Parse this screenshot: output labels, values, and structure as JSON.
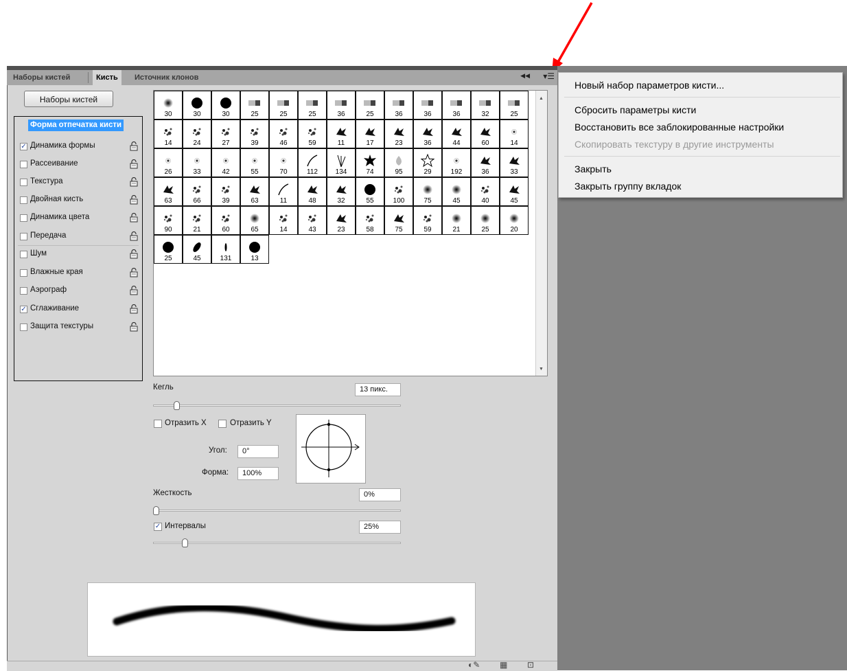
{
  "tabs": [
    {
      "label": "Наборы кистей",
      "active": false
    },
    {
      "label": "Кисть",
      "active": true
    },
    {
      "label": "Источник клонов",
      "active": false
    }
  ],
  "panel_controls": {
    "collapse_icon": "double-chevron-left-icon",
    "menu_icon": "panel-menu-icon"
  },
  "presets_button": "Наборы кистей",
  "options": {
    "header": "Форма отпечатка кисти",
    "items": [
      {
        "label": "Динамика формы",
        "checked": true,
        "lock": true
      },
      {
        "label": "Рассеивание",
        "checked": false,
        "lock": true
      },
      {
        "label": "Текстура",
        "checked": false,
        "lock": true
      },
      {
        "label": "Двойная кисть",
        "checked": false,
        "lock": true
      },
      {
        "label": "Динамика цвета",
        "checked": false,
        "lock": true
      },
      {
        "label": "Передача",
        "checked": false,
        "lock": true
      },
      {
        "label": "Шум",
        "checked": false,
        "lock": true
      },
      {
        "label": "Влажные края",
        "checked": false,
        "lock": true
      },
      {
        "label": "Аэрограф",
        "checked": false,
        "lock": true
      },
      {
        "label": "Сглаживание",
        "checked": true,
        "lock": true
      },
      {
        "label": "Защита текстуры",
        "checked": false,
        "lock": true
      }
    ]
  },
  "brushes": [
    {
      "size": "30",
      "shape": "soft"
    },
    {
      "size": "30",
      "shape": "hard"
    },
    {
      "size": "30",
      "shape": "hard"
    },
    {
      "size": "25",
      "shape": "bristle"
    },
    {
      "size": "25",
      "shape": "bristle"
    },
    {
      "size": "25",
      "shape": "bristle"
    },
    {
      "size": "36",
      "shape": "bristle"
    },
    {
      "size": "25",
      "shape": "bristle"
    },
    {
      "size": "36",
      "shape": "bristle"
    },
    {
      "size": "36",
      "shape": "bristle"
    },
    {
      "size": "36",
      "shape": "bristle"
    },
    {
      "size": "32",
      "shape": "bristle"
    },
    {
      "size": "25",
      "shape": "bristle"
    },
    {
      "size": "14",
      "shape": "splatter"
    },
    {
      "size": "24",
      "shape": "splatter"
    },
    {
      "size": "27",
      "shape": "splatter"
    },
    {
      "size": "39",
      "shape": "splatter"
    },
    {
      "size": "46",
      "shape": "splatter"
    },
    {
      "size": "59",
      "shape": "splatter"
    },
    {
      "size": "11",
      "shape": "leaf"
    },
    {
      "size": "17",
      "shape": "leaf"
    },
    {
      "size": "23",
      "shape": "leaf"
    },
    {
      "size": "36",
      "shape": "leaf"
    },
    {
      "size": "44",
      "shape": "leaf"
    },
    {
      "size": "60",
      "shape": "leaf"
    },
    {
      "size": "14",
      "shape": "dot"
    },
    {
      "size": "26",
      "shape": "dot"
    },
    {
      "size": "33",
      "shape": "dot"
    },
    {
      "size": "42",
      "shape": "dot"
    },
    {
      "size": "55",
      "shape": "dot"
    },
    {
      "size": "70",
      "shape": "dot"
    },
    {
      "size": "112",
      "shape": "stroke"
    },
    {
      "size": "134",
      "shape": "grass"
    },
    {
      "size": "74",
      "shape": "maple"
    },
    {
      "size": "95",
      "shape": "petal"
    },
    {
      "size": "29",
      "shape": "star"
    },
    {
      "size": "192",
      "shape": "dot"
    },
    {
      "size": "36",
      "shape": "leaf"
    },
    {
      "size": "33",
      "shape": "leaf"
    },
    {
      "size": "63",
      "shape": "leaf"
    },
    {
      "size": "66",
      "shape": "splatter"
    },
    {
      "size": "39",
      "shape": "splatter"
    },
    {
      "size": "63",
      "shape": "leaf"
    },
    {
      "size": "11",
      "shape": "stroke"
    },
    {
      "size": "48",
      "shape": "leaf"
    },
    {
      "size": "32",
      "shape": "leaf"
    },
    {
      "size": "55",
      "shape": "hard"
    },
    {
      "size": "100",
      "shape": "splatter"
    },
    {
      "size": "75",
      "shape": "soft"
    },
    {
      "size": "45",
      "shape": "soft"
    },
    {
      "size": "40",
      "shape": "splatter"
    },
    {
      "size": "45",
      "shape": "leaf"
    },
    {
      "size": "90",
      "shape": "splatter"
    },
    {
      "size": "21",
      "shape": "splatter"
    },
    {
      "size": "60",
      "shape": "splatter"
    },
    {
      "size": "65",
      "shape": "soft"
    },
    {
      "size": "14",
      "shape": "splatter"
    },
    {
      "size": "43",
      "shape": "splatter"
    },
    {
      "size": "23",
      "shape": "leaf"
    },
    {
      "size": "58",
      "shape": "splatter"
    },
    {
      "size": "75",
      "shape": "leaf"
    },
    {
      "size": "59",
      "shape": "splatter"
    },
    {
      "size": "21",
      "shape": "soft"
    },
    {
      "size": "25",
      "shape": "soft"
    },
    {
      "size": "20",
      "shape": "soft"
    },
    {
      "size": "25",
      "shape": "hard"
    },
    {
      "size": "45",
      "shape": "ellipse"
    },
    {
      "size": "131",
      "shape": "narrow"
    },
    {
      "size": "13",
      "shape": "hard"
    }
  ],
  "size_field": {
    "label": "Кегль",
    "value": "13 пикс.",
    "slider_fraction": 0.04
  },
  "flip": {
    "x_label": "Отразить X",
    "x_checked": false,
    "y_label": "Отразить Y",
    "y_checked": false
  },
  "angle": {
    "label": "Угол:",
    "value": "0°"
  },
  "roundness": {
    "label": "Форма:",
    "value": "100%"
  },
  "hardness": {
    "label": "Жесткость",
    "value": "0%",
    "slider_fraction": 0.0
  },
  "spacing": {
    "label": "Интервалы",
    "value": "25%",
    "checked": true,
    "slider_fraction": 0.12
  },
  "dropdown": [
    {
      "label": "Новый набор параметров кисти...",
      "enabled": true
    },
    {
      "label": "Сбросить параметры кисти",
      "enabled": true
    },
    {
      "label": "Восстановить все заблокированные настройки",
      "enabled": true
    },
    {
      "label": "Скопировать текстуру в другие инструменты",
      "enabled": false
    },
    {
      "label": "Закрыть",
      "enabled": true
    },
    {
      "label": "Закрыть группу вкладок",
      "enabled": true
    }
  ],
  "colors": {
    "panel": "#d6d6d6",
    "workspace": "#808080",
    "selection": "#3399ff",
    "annotation_arrow": "#ff0000"
  }
}
